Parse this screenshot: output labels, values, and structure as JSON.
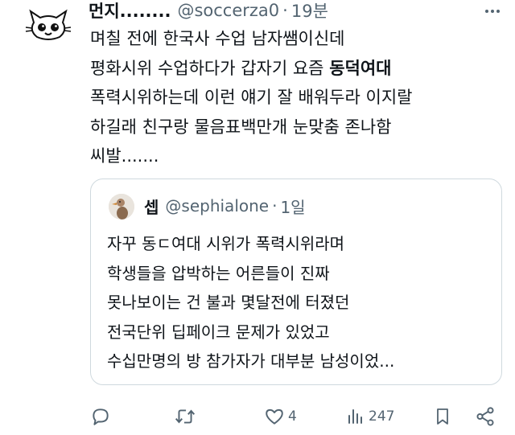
{
  "tweet": {
    "author_name": "먼지........",
    "handle": "@soccerza0",
    "separator": "·",
    "time": "19분",
    "body_lines": [
      "며칠 전에 한국사 수업 남자쌤이신데",
      "평화시위 수업하다가 갑자기 요즘 ",
      "폭력시위하는데 이런 얘기 잘 배워두라 이지랄",
      "하길래 친구랑 물음표백만개 눈맞춤 존나함",
      "씨발......."
    ],
    "body_bold": "동덕여대"
  },
  "quote": {
    "author_name": "셉",
    "handle": "@sephialone",
    "separator": "·",
    "time": "1일",
    "lines": [
      "자꾸 동ㄷ여대 시위가 폭력시위라며",
      "학생들을 압박하는 어른들이 진짜",
      "못나보이는 건 불과 몇달전에 터졌던",
      "전국단위 딥페이크 문제가 있었고",
      "수십만명의 방 참가자가 대부분 남성이었..."
    ]
  },
  "actions": {
    "reply_count": "",
    "retweet_count": "",
    "like_count": "4",
    "view_count": "247"
  },
  "colors": {
    "text": "#0f1419",
    "secondary": "#536471",
    "border": "#cfd9de"
  }
}
